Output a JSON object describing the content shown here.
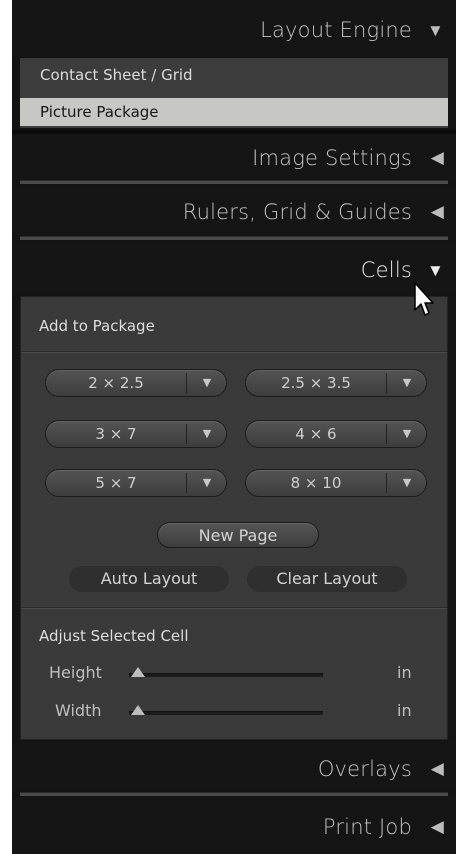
{
  "panel": {
    "layout_engine": {
      "title": "Layout Engine",
      "arrow": "▼",
      "options": [
        {
          "label": "Contact Sheet / Grid",
          "selected": false
        },
        {
          "label": "Picture Package",
          "selected": true
        }
      ]
    },
    "image_settings": {
      "title": "Image Settings",
      "arrow": "◀"
    },
    "rulers": {
      "title": "Rulers, Grid & Guides",
      "arrow": "◀"
    },
    "cells": {
      "title": "Cells",
      "arrow": "▼",
      "add_to_package": {
        "title": "Add to Package",
        "sizes": [
          "2 × 2.5",
          "2.5 × 3.5",
          "3 × 7",
          "4 × 6",
          "5 × 7",
          "8 × 10"
        ],
        "dropdown_arrow": "▼"
      },
      "new_page": "New Page",
      "auto_layout": "Auto Layout",
      "clear_layout": "Clear Layout",
      "adjust": {
        "title": "Adjust Selected Cell",
        "height_label": "Height",
        "width_label": "Width",
        "height_unit": "in",
        "width_unit": "in",
        "height_value_fraction": 0.0,
        "width_value_fraction": 0.0
      }
    },
    "overlays": {
      "title": "Overlays",
      "arrow": "◀"
    },
    "print_job": {
      "title": "Print Job",
      "arrow": "◀"
    }
  },
  "colors": {
    "panel_bg": "#141414",
    "section_bg": "#3a3a3a",
    "selected_item_bg": "#c7c8c4",
    "text": "#c4c4c4"
  },
  "icons": {
    "cursor": "pointer-arrow-icon"
  }
}
